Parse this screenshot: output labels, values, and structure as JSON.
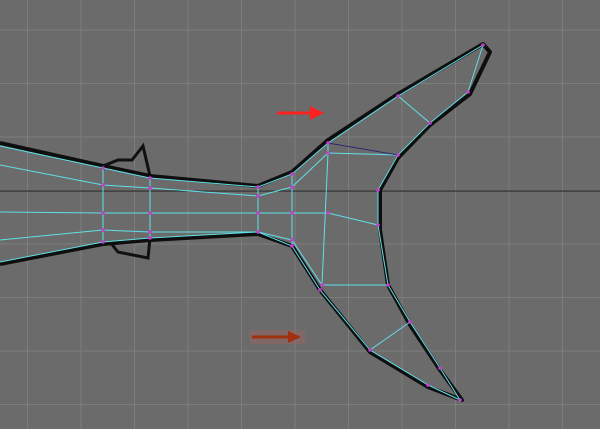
{
  "viewport": {
    "background_color": "#6b6b6b",
    "grid_color": "#7d7d7d",
    "axis_color": "#1e1e1e",
    "wire_color": "#5fe0e8",
    "edge_selected_color": "#2a2a70",
    "vertex_color": "#c040d0",
    "outline_color": "#101010"
  },
  "annotations": [
    {
      "name": "upper-arrow",
      "color": "#ff2020"
    },
    {
      "name": "lower-arrow",
      "color": "#a03010"
    }
  ]
}
